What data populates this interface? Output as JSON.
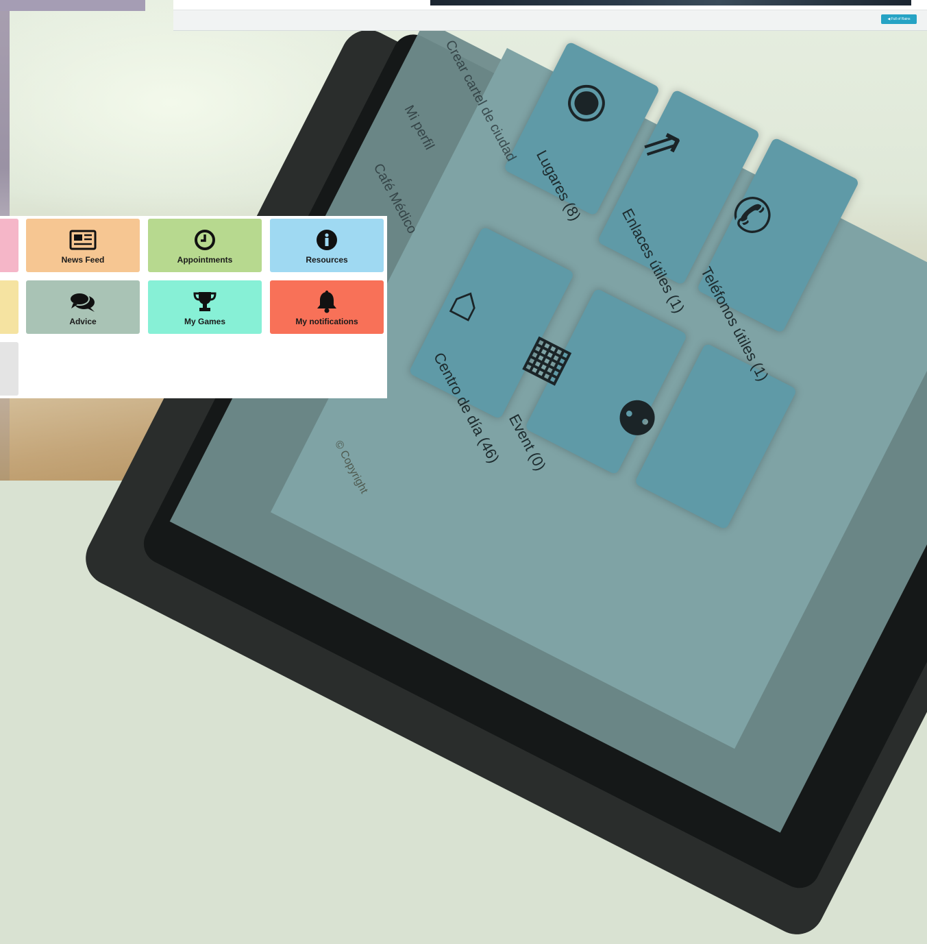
{
  "background_tablet": {
    "menu": [
      "Crear cartel de ciudad",
      "Mi perfil",
      "Café Médico"
    ],
    "tiles": [
      {
        "label": "Lugares (8)",
        "icon": "globe-icon"
      },
      {
        "label": "Enlaces útiles (1)",
        "icon": "external-link-icon"
      },
      {
        "label": "Teléfonos útiles (1)",
        "icon": "phone-icon"
      },
      {
        "label": "Centro de día (46)",
        "icon": "home-icon"
      },
      {
        "label": "Event (0)",
        "icon": "calendar-icon"
      },
      {
        "label": "",
        "icon": "users-icon"
      }
    ],
    "copyright": "© Copyright"
  },
  "topbar": {
    "button_label": "◀ Full of Rains"
  },
  "grid": {
    "items": [
      {
        "label": "News Feed",
        "icon": "newspaper-icon",
        "color": "#f6c692"
      },
      {
        "label": "Appointments",
        "icon": "clock-icon",
        "color": "#b7d98f"
      },
      {
        "label": "Resources",
        "icon": "info-icon",
        "color": "#9fd9f2"
      },
      {
        "label": "Advice",
        "icon": "chat-bubbles-icon",
        "color": "#a9c3b5"
      },
      {
        "label": "My Games",
        "icon": "trophy-icon",
        "color": "#87f0d6"
      },
      {
        "label": "My notifications",
        "icon": "bell-icon",
        "color": "#f87158"
      }
    ],
    "edge_colors": [
      "#f5b6c8",
      "#f5e3a1",
      "#e4e4e4"
    ]
  }
}
